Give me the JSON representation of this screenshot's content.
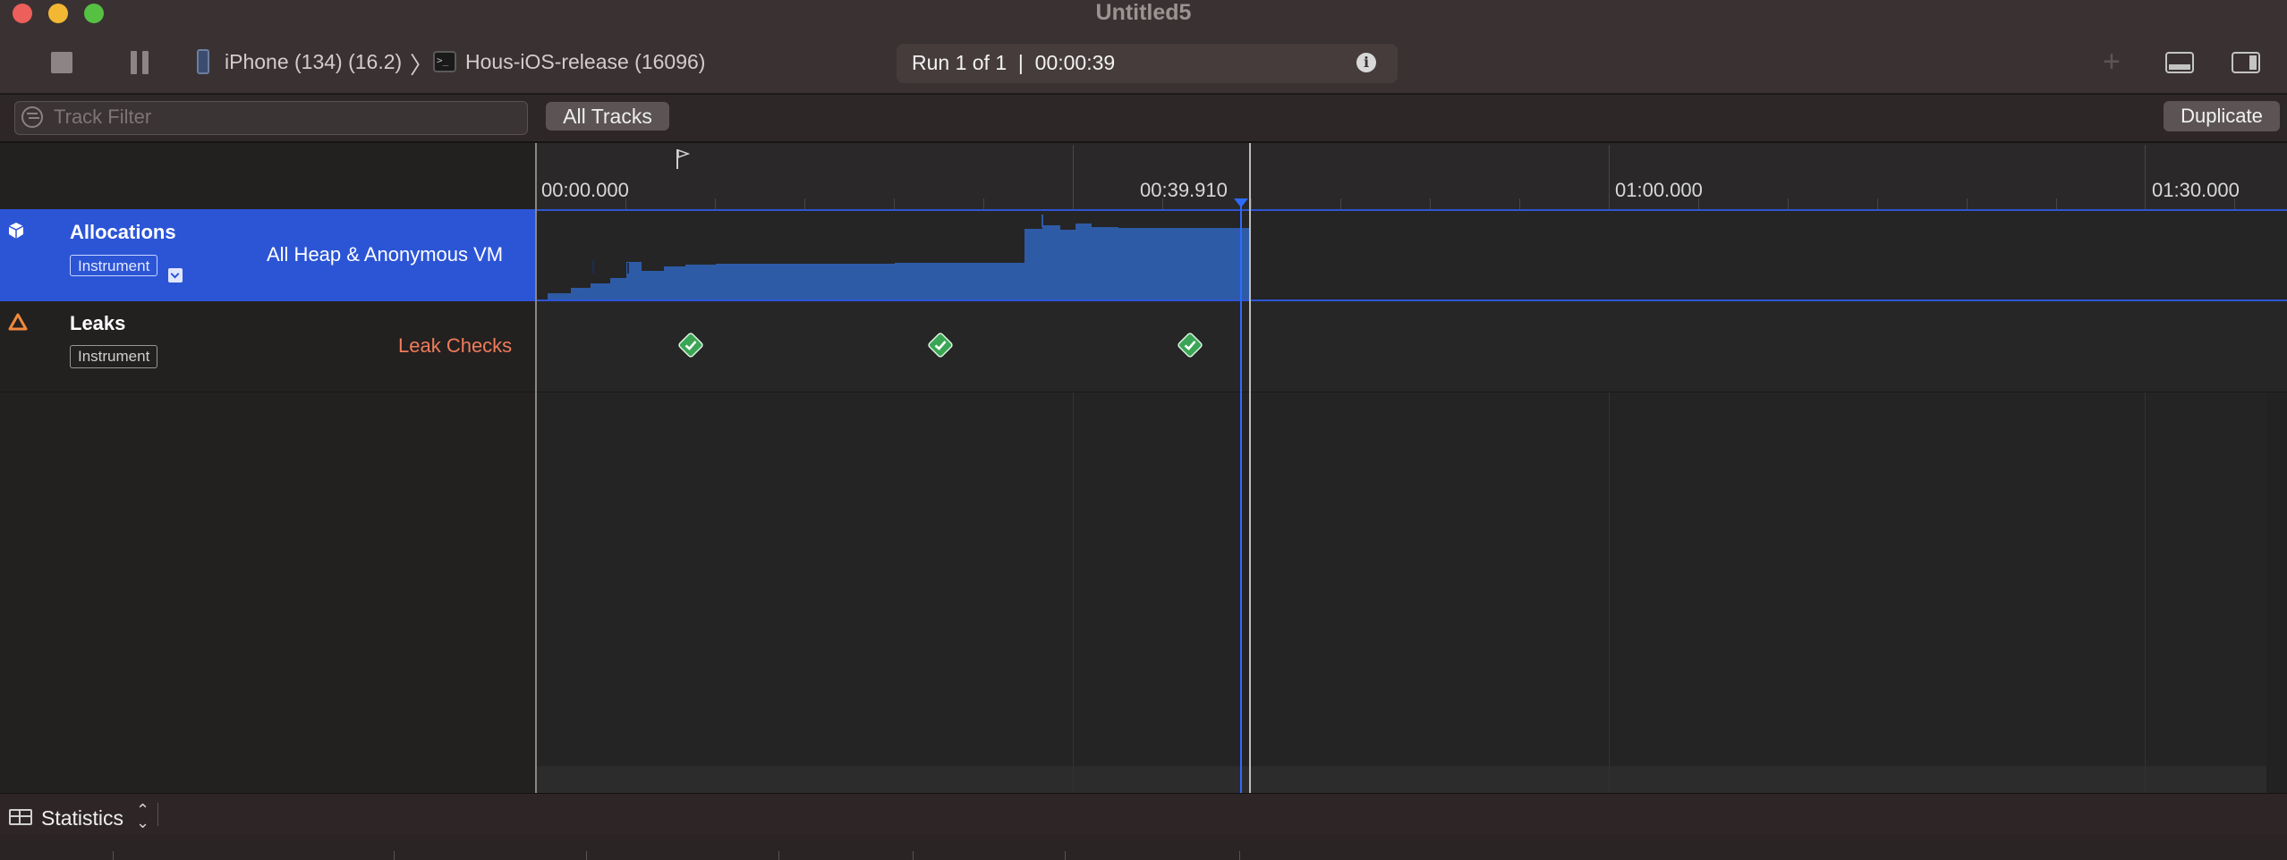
{
  "window": {
    "title": "Untitled5",
    "traffic_lights": {
      "close": "#ec5f5b",
      "minimize": "#f2b834",
      "zoom": "#56c043"
    }
  },
  "toolbar": {
    "device": "iPhone (134) (16.2)",
    "target": "Hous-iOS-release (16096)",
    "run_status": "Run 1 of 1  |  00:00:39",
    "icons": [
      "stop-icon",
      "pause-icon",
      "phone-icon",
      "terminal-icon",
      "info-icon",
      "add-icon",
      "bottom-panel-icon",
      "right-panel-icon"
    ]
  },
  "filter_bar": {
    "placeholder": "Track Filter",
    "scope_button": "All Tracks",
    "duplicate_button": "Duplicate"
  },
  "ruler": {
    "labels": [
      "00:00.000",
      "00:39.910",
      "01:00.000",
      "01:30.000"
    ]
  },
  "tracks": [
    {
      "name": "Allocations",
      "badge": "Instrument",
      "detail": "All Heap & Anonymous VM",
      "selected": true,
      "accent": "#2c55d6"
    },
    {
      "name": "Leaks",
      "badge": "Instrument",
      "detail": "Leak Checks",
      "selected": false,
      "detail_color": "#f07c5a"
    }
  ],
  "leak_checks": {
    "count": 3,
    "status": "passed",
    "color": "#3aa655"
  },
  "bottom_bar": {
    "view_selector": "Statistics"
  }
}
